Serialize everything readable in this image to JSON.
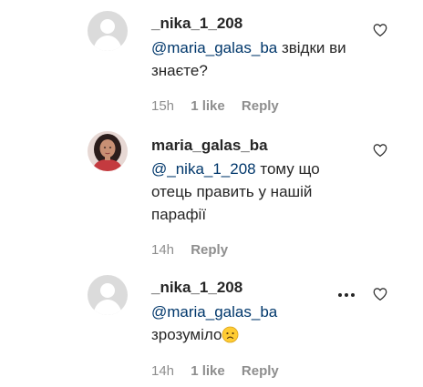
{
  "comments": [
    {
      "username": "_nika_1_208",
      "mention": "@maria_galas_ba",
      "text_after_mention": " звідки ви знаєте?",
      "time": "15h",
      "likes": "1 like",
      "reply": "Reply",
      "avatar": "default-avatar-icon"
    },
    {
      "username": "maria_galas_ba",
      "mention": "@_nika_1_208",
      "text_after_mention": " тому що отець править у нашій парафії",
      "time": "14h",
      "reply": "Reply",
      "avatar": "profile-photo"
    },
    {
      "username": "_nika_1_208",
      "mention": "@maria_galas_ba",
      "text_after_mention": "зрозуміло",
      "emoji": "disappointed-face-emoji",
      "time": "14h",
      "likes": "1 like",
      "reply": "Reply",
      "avatar": "default-avatar-icon",
      "more_options": "more-options-icon"
    }
  ],
  "colors": {
    "text": "#262626",
    "mention": "#00376b",
    "meta": "#8e8e8e",
    "avatar_placeholder": "#dbdbdb"
  }
}
